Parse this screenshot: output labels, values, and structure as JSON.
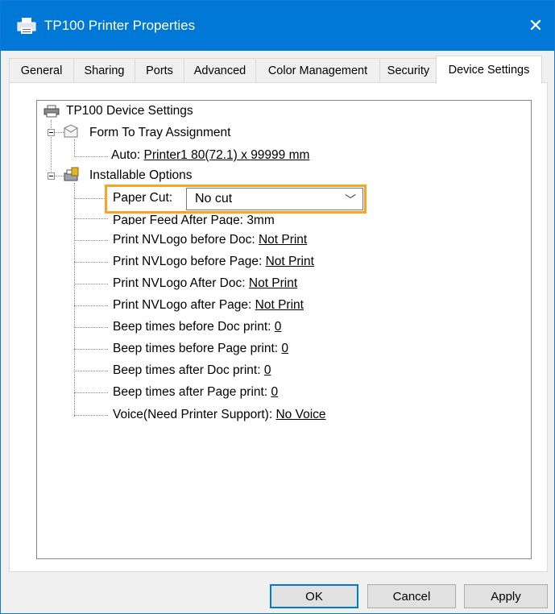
{
  "window": {
    "title": "TP100 Printer Properties",
    "close_glyph": "✕"
  },
  "tabs": [
    {
      "label": "General"
    },
    {
      "label": "Sharing"
    },
    {
      "label": "Ports"
    },
    {
      "label": "Advanced"
    },
    {
      "label": "Color Management"
    },
    {
      "label": "Security"
    },
    {
      "label": "Device Settings",
      "active": true
    }
  ],
  "tree": {
    "root": "TP100 Device Settings",
    "form_to_tray": {
      "label": "Form To Tray Assignment",
      "auto_label": "Auto:",
      "auto_value": "Printer1 80(72.1) x 99999 mm"
    },
    "installable": {
      "label": "Installable Options",
      "paper_cut": {
        "label": "Paper Cut:",
        "value": "No cut"
      },
      "items": [
        {
          "label": "Paper Feed After Page:",
          "value": "3mm"
        },
        {
          "label": "Print NVLogo before Doc:",
          "value": "Not Print"
        },
        {
          "label": "Print NVLogo before Page:",
          "value": "Not Print"
        },
        {
          "label": "Print NVLogo After Doc:",
          "value": "Not Print"
        },
        {
          "label": "Print NVLogo after Page:",
          "value": "Not Print"
        },
        {
          "label": "Beep times before Doc print:",
          "value": "0"
        },
        {
          "label": "Beep times before Page print:",
          "value": "0"
        },
        {
          "label": "Beep times after Doc print:",
          "value": "0"
        },
        {
          "label": "Beep times after Page print:",
          "value": "0"
        },
        {
          "label": "Voice(Need Printer Support):",
          "value": "No Voice"
        }
      ]
    }
  },
  "buttons": {
    "ok": "OK",
    "cancel": "Cancel",
    "apply": "Apply"
  },
  "colors": {
    "title_bar": "#0078d7",
    "highlight": "#f5a623"
  }
}
